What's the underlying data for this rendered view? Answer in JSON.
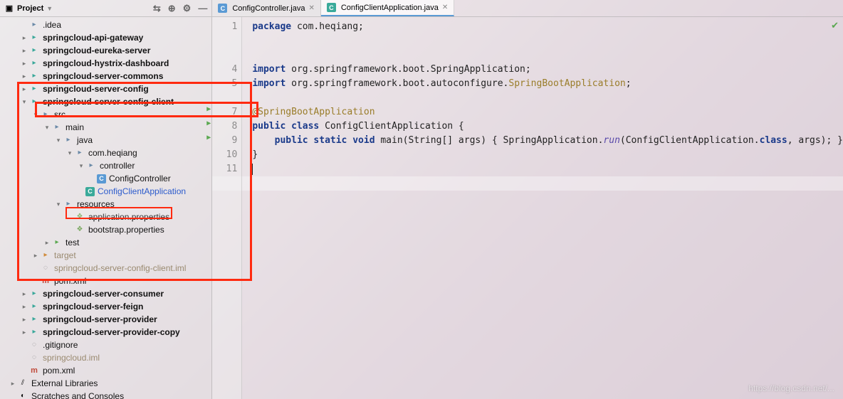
{
  "sidebar": {
    "title": "Project",
    "tree": [
      {
        "depth": 1,
        "icon": "folder",
        "label": ".idea",
        "bold": false,
        "arrow": ""
      },
      {
        "depth": 1,
        "icon": "folder-teal",
        "label": "springcloud-api-gateway",
        "bold": true,
        "arrow": "▸"
      },
      {
        "depth": 1,
        "icon": "folder-teal",
        "label": "springcloud-eureka-server",
        "bold": true,
        "arrow": "▸"
      },
      {
        "depth": 1,
        "icon": "folder-teal",
        "label": "springcloud-hystrix-dashboard",
        "bold": true,
        "arrow": "▸"
      },
      {
        "depth": 1,
        "icon": "folder-teal",
        "label": "springcloud-server-commons",
        "bold": true,
        "arrow": "▸"
      },
      {
        "depth": 1,
        "icon": "folder-teal",
        "label": "springcloud-server-config",
        "bold": true,
        "arrow": "▸"
      },
      {
        "depth": 1,
        "icon": "folder-teal",
        "label": "springcloud-server-config-client",
        "bold": true,
        "arrow": "▾"
      },
      {
        "depth": 2,
        "icon": "folder",
        "label": "src",
        "bold": false,
        "arrow": "▾"
      },
      {
        "depth": 3,
        "icon": "folder",
        "label": "main",
        "bold": false,
        "arrow": "▾"
      },
      {
        "depth": 4,
        "icon": "folder",
        "label": "java",
        "bold": false,
        "arrow": "▾"
      },
      {
        "depth": 5,
        "icon": "folder",
        "label": "com.heqiang",
        "bold": false,
        "arrow": "▾"
      },
      {
        "depth": 6,
        "icon": "folder",
        "label": "controller",
        "bold": false,
        "arrow": "▾"
      },
      {
        "depth": 7,
        "icon": "c-blue",
        "label": "ConfigController",
        "bold": false,
        "arrow": ""
      },
      {
        "depth": 6,
        "icon": "c-teal",
        "label": "ConfigClientApplication",
        "bold": false,
        "arrow": "",
        "selected": true
      },
      {
        "depth": 4,
        "icon": "folder",
        "label": "resources",
        "bold": false,
        "arrow": "▾"
      },
      {
        "depth": 5,
        "icon": "leaf",
        "label": "application.properties",
        "bold": false,
        "arrow": ""
      },
      {
        "depth": 5,
        "icon": "leaf",
        "label": "bootstrap.properties",
        "bold": false,
        "arrow": ""
      },
      {
        "depth": 3,
        "icon": "folder-green",
        "label": "test",
        "bold": false,
        "arrow": "▸"
      },
      {
        "depth": 2,
        "icon": "folder-orange",
        "label": "target",
        "bold": false,
        "arrow": "▸",
        "muted": true
      },
      {
        "depth": 2,
        "icon": "dot",
        "label": "springcloud-server-config-client.iml",
        "bold": false,
        "arrow": "",
        "muted": true
      },
      {
        "depth": 2,
        "icon": "m-red",
        "label": "pom.xml",
        "bold": false,
        "arrow": ""
      },
      {
        "depth": 1,
        "icon": "folder-teal",
        "label": "springcloud-server-consumer",
        "bold": true,
        "arrow": "▸"
      },
      {
        "depth": 1,
        "icon": "folder-teal",
        "label": "springcloud-server-feign",
        "bold": true,
        "arrow": "▸"
      },
      {
        "depth": 1,
        "icon": "folder-teal",
        "label": "springcloud-server-provider",
        "bold": true,
        "arrow": "▸"
      },
      {
        "depth": 1,
        "icon": "folder-teal",
        "label": "springcloud-server-provider-copy",
        "bold": true,
        "arrow": "▸"
      },
      {
        "depth": 1,
        "icon": "dot",
        "label": ".gitignore",
        "bold": false,
        "arrow": ""
      },
      {
        "depth": 1,
        "icon": "dot",
        "label": "springcloud.iml",
        "bold": false,
        "arrow": "",
        "muted": true
      },
      {
        "depth": 1,
        "icon": "m-red",
        "label": "pom.xml",
        "bold": false,
        "arrow": ""
      },
      {
        "depth": 0,
        "icon": "lib",
        "label": "External Libraries",
        "bold": false,
        "arrow": "▸"
      },
      {
        "depth": 0,
        "icon": "scratch",
        "label": "Scratches and Consoles",
        "bold": false,
        "arrow": ""
      }
    ]
  },
  "tabs": [
    {
      "icon": "c-blue",
      "label": "ConfigController.java",
      "active": false
    },
    {
      "icon": "c-teal",
      "label": "ConfigClientApplication.java",
      "active": true
    }
  ],
  "gutter_lines": [
    "1",
    "",
    "",
    "4",
    "5",
    "",
    "7",
    "8",
    "9",
    "10",
    "11"
  ],
  "code": {
    "l1_pkg_kw": "package ",
    "l1_pkg": "com.heqiang;",
    "l4_imp_kw": "import ",
    "l4_imp": "org.springframework.boot.SpringApplication;",
    "l5_imp_kw": "import ",
    "l5_imp_a": "org.springframework.boot.autoconfigure.",
    "l5_imp_b": "SpringBootApplication",
    "l5_imp_c": ";",
    "l7_ann": "@SpringBootApplication",
    "l8_a": "public class ",
    "l8_b": "ConfigClientApplication {",
    "l9_a": "    public static void ",
    "l9_b": "main",
    "l9_c": "(String[] args) { SpringApplication.",
    "l9_d": "run",
    "l9_e": "(ConfigClientApplication.",
    "l9_f": "class",
    "l9_g": ", args); }",
    "l10": "}",
    "l11": ""
  },
  "watermark": "https://blog.csdn.net/..."
}
